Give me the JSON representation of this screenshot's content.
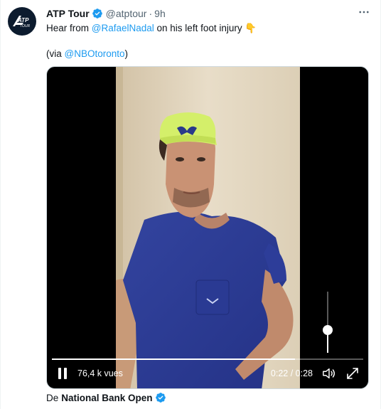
{
  "author": {
    "name": "ATP Tour",
    "handle": "@atptour",
    "separator": "·",
    "time": "9h",
    "avatar_logo_text": "ATP TOUR"
  },
  "tweet": {
    "line1_prefix": "Hear from ",
    "mention1": "@RafaelNadal",
    "line1_suffix": " on his left foot injury",
    "emoji": "👇",
    "line2_prefix": "(via ",
    "mention2": "@NBOtoronto",
    "line2_suffix": ")"
  },
  "video": {
    "views": "76,4 k vues",
    "timecode": "0:22 / 0:28",
    "progress_fraction": 0.78,
    "volume_fraction": 0.37
  },
  "source": {
    "prefix": "De",
    "name": "National Bank Open"
  },
  "colors": {
    "accent": "#1d9bf0",
    "text": "#0f1419",
    "secondary": "#536471",
    "cap": "#d4ef6a",
    "shirt": "#2d3d99"
  },
  "icons": [
    "verified-badge-icon",
    "more-options-icon",
    "pause-icon",
    "volume-icon",
    "fullscreen-icon"
  ]
}
